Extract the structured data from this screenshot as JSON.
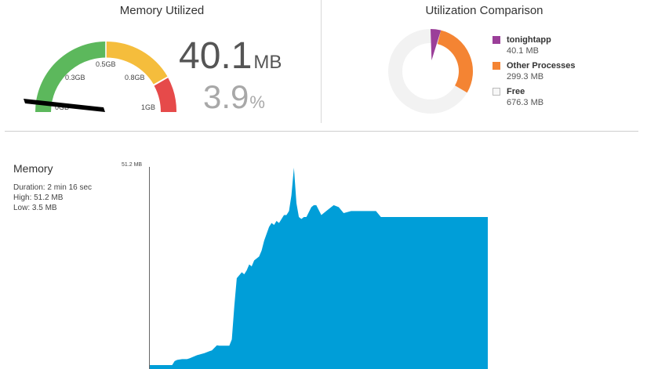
{
  "gauge": {
    "title": "Memory Utilized",
    "ticks": [
      "0.3GB",
      "0.5GB",
      "0.8GB",
      "1GB",
      "0GB"
    ],
    "needle_fraction": 0.039,
    "value": "40.1",
    "value_unit": "MB",
    "percent": "3.9",
    "percent_unit": "%",
    "colors": {
      "green": "#5cb85c",
      "yellow": "#f5bd3c",
      "red": "#e64a4a",
      "needle": "#000000"
    }
  },
  "comparison": {
    "title": "Utilization Comparison",
    "legend": [
      {
        "name": "tonightapp",
        "value": "40.1 MB",
        "mb": 40.1,
        "color": "#9b3f99"
      },
      {
        "name": "Other Processes",
        "value": "299.3 MB",
        "mb": 299.3,
        "color": "#f48433"
      },
      {
        "name": "Free",
        "value": "676.3 MB",
        "mb": 676.3,
        "color": "#f2f2f2"
      }
    ]
  },
  "memory": {
    "title": "Memory",
    "duration": "Duration: 2 min 16 sec",
    "high": "High: 51.2 MB",
    "low": "Low: 3.5 MB",
    "y_max_label": "51.2 MB"
  },
  "chart_data": {
    "type": "area",
    "title": "Memory",
    "xlabel": "",
    "ylabel": "",
    "ylim": [
      0,
      51.2
    ],
    "xlim": [
      0,
      136
    ],
    "x": [
      0,
      9,
      10,
      11,
      13,
      15,
      16,
      19,
      22,
      24,
      25,
      27,
      28,
      29,
      30,
      32,
      33,
      34,
      35,
      37,
      38,
      39,
      40,
      41,
      42,
      43,
      44,
      45,
      46,
      48,
      49,
      50,
      51,
      52,
      53,
      54,
      55,
      56,
      57,
      58,
      59,
      60,
      61,
      62,
      63,
      65,
      66,
      67,
      69,
      71,
      73,
      74,
      76,
      78,
      81,
      84,
      86,
      88,
      91,
      93,
      97,
      102,
      115,
      136
    ],
    "values": [
      1.0,
      1.0,
      2.0,
      2.3,
      2.5,
      2.5,
      2.7,
      3.5,
      4.0,
      4.5,
      4.7,
      6.0,
      5.9,
      5.9,
      5.9,
      5.9,
      7.5,
      16.0,
      23.0,
      24.5,
      24.0,
      25.0,
      26.5,
      26.0,
      27.5,
      28.0,
      28.5,
      30.0,
      32.5,
      36.0,
      37.0,
      36.5,
      37.5,
      37.0,
      38.0,
      39.0,
      39.0,
      40.0,
      44.0,
      51.0,
      42.0,
      38.5,
      38.0,
      38.5,
      38.5,
      41.0,
      41.5,
      41.5,
      39.0,
      40.0,
      41.0,
      41.5,
      41.0,
      39.5,
      40.0,
      40.0,
      40.0,
      40.0,
      40.0,
      38.5,
      38.5,
      38.5,
      38.5,
      38.5
    ],
    "fill": "#009ed8"
  }
}
